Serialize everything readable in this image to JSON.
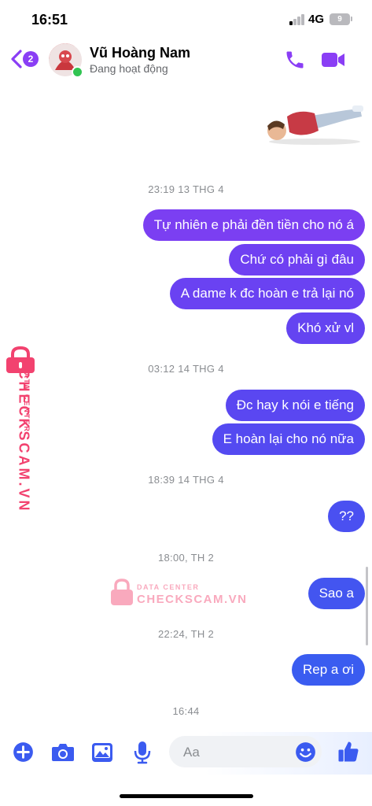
{
  "status": {
    "time": "16:51",
    "network": "4G",
    "battery": "9"
  },
  "header": {
    "back_badge": "2",
    "name": "Vũ Hoàng Nam",
    "status": "Đang hoạt động"
  },
  "messages": [
    {
      "type": "timestamp",
      "text": "23:19 13 THG 4"
    },
    {
      "type": "out",
      "text": "Tự nhiên e phải đền tiền cho nó á"
    },
    {
      "type": "out",
      "text": "Chứ có phải gì đâu"
    },
    {
      "type": "out",
      "text": "A dame k đc hoàn e trả lại nó"
    },
    {
      "type": "out",
      "text": "Khó xử vl"
    },
    {
      "type": "timestamp",
      "text": "03:12 14 THG 4"
    },
    {
      "type": "out",
      "text": "Đc hay k nói e tiếng"
    },
    {
      "type": "out",
      "text": "E hoàn lại cho nó nữa"
    },
    {
      "type": "timestamp",
      "text": "18:39 14 THG 4"
    },
    {
      "type": "out",
      "text": "??"
    },
    {
      "type": "timestamp",
      "text": "18:00, TH 2"
    },
    {
      "type": "out",
      "text": "Sao a"
    },
    {
      "type": "timestamp",
      "text": "22:24, TH 2"
    },
    {
      "type": "out",
      "text": "Rep a ơi"
    },
    {
      "type": "timestamp",
      "text": "16:44"
    }
  ],
  "composer": {
    "placeholder": "Aa"
  },
  "watermark": {
    "line1": "DATA CENTER",
    "line2": "CHECKSCAM.VN"
  },
  "colors": {
    "accent": "#8a3ef5",
    "bubble_top": "#7b3ff2",
    "bubble_bottom": "#3a5cf0",
    "watermark": "#f2426f"
  },
  "icons": [
    "back-chevron-icon",
    "phone-icon",
    "video-call-icon",
    "plus-icon",
    "camera-icon",
    "image-icon",
    "microphone-icon",
    "emoji-icon",
    "thumbs-up-icon"
  ]
}
